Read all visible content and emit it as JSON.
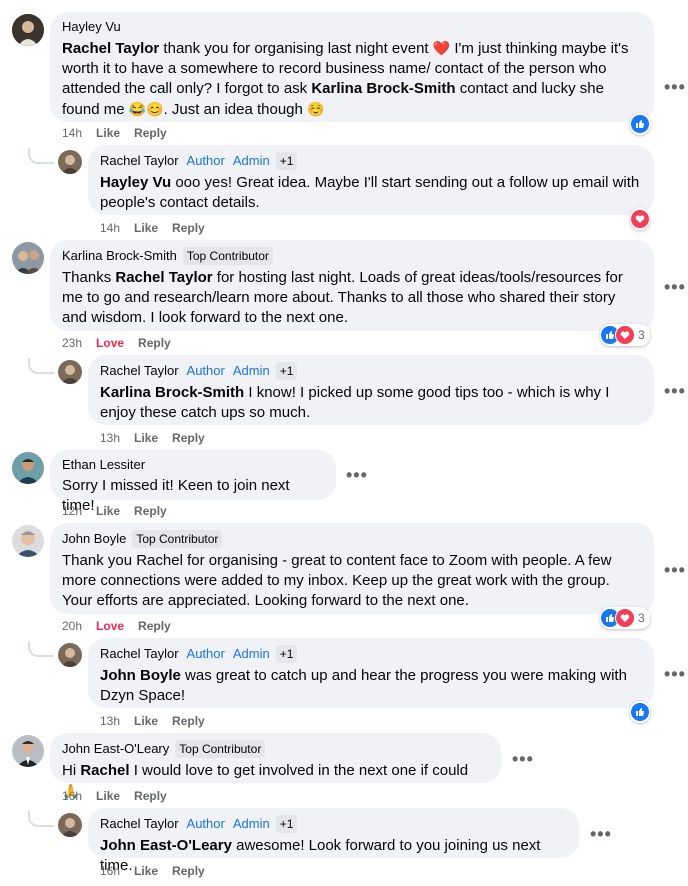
{
  "comments": [
    {
      "name": "Hayley Vu",
      "text": [
        "Rachel Taylor",
        " thank you for organising last night event ",
        "❤️",
        " I'm just thinking maybe it's worth it to have a somewhere to record business name/ contact of the person who attended the call only? I forgot to ask ",
        "Karlina Brock-Smith",
        " contact and lucky she found me ",
        "😂😊",
        ". Just an idea though ",
        "☺️"
      ],
      "time": "14h",
      "like": "Like",
      "reply": "Reply",
      "reply_item": {
        "name": "Rachel Taylor",
        "author": "Author",
        "admin": "Admin",
        "plus": "+1",
        "mention": "Hayley Vu",
        "text": " ooo yes! Great idea. Maybe I'll start sending out a follow up email with people's contact details.",
        "time": "14h",
        "like": "Like",
        "reply": "Reply"
      }
    },
    {
      "name": "Karlina Brock-Smith",
      "badge": "Top Contributor",
      "text_pre": "Thanks ",
      "mention": "Rachel Taylor",
      "text": " for hosting last night. Loads of great ideas/tools/resources for me to go and research/learn more about. Thanks to all those who shared their story and wisdom. I look forward to the next one.",
      "time": "23h",
      "love": "Love",
      "reply": "Reply",
      "react_count": "3",
      "reply_item": {
        "name": "Rachel Taylor",
        "author": "Author",
        "admin": "Admin",
        "plus": "+1",
        "mention": "Karlina Brock-Smith",
        "text": " I know! I picked up some good tips too - which is why I enjoy these catch ups so much.",
        "time": "13h",
        "like": "Like",
        "reply": "Reply"
      }
    },
    {
      "name": "Ethan Lessiter",
      "text": "Sorry I missed it! Keen to join next time!",
      "time": "12h",
      "like": "Like",
      "reply": "Reply"
    },
    {
      "name": "John Boyle",
      "badge": "Top Contributor",
      "text": "Thank you Rachel for organising - great to content face to Zoom with people. A few more connections were added to my inbox. Keep up the great work with the group. Your efforts are appreciated. Looking forward to the next one.",
      "time": "20h",
      "love": "Love",
      "reply": "Reply",
      "react_count": "3",
      "reply_item": {
        "name": "Rachel Taylor",
        "author": "Author",
        "admin": "Admin",
        "plus": "+1",
        "mention": "John Boyle",
        "text": " was great to catch up and hear the progress you were making with Dzyn Space!",
        "time": "13h",
        "like": "Like",
        "reply": "Reply"
      }
    },
    {
      "name": "John East-O'Leary",
      "badge": "Top Contributor",
      "text_pre": "Hi ",
      "mention": "Rachel",
      "text": " I would love to get involved in the next one if could ",
      "emoji": "🙏",
      "time": "16h",
      "like": "Like",
      "reply": "Reply",
      "reply_item": {
        "name": "Rachel Taylor",
        "author": "Author",
        "admin": "Admin",
        "plus": "+1",
        "mention": "John East-O'Leary",
        "text": " awesome! Look forward to you joining us next time.",
        "time": "16h",
        "like": "Like",
        "reply": "Reply"
      }
    }
  ],
  "more": "•••",
  "colors": {
    "accent": "#1b74e4",
    "love": "#f02849",
    "bubble": "#f0f2f5",
    "muted": "#65676b"
  }
}
